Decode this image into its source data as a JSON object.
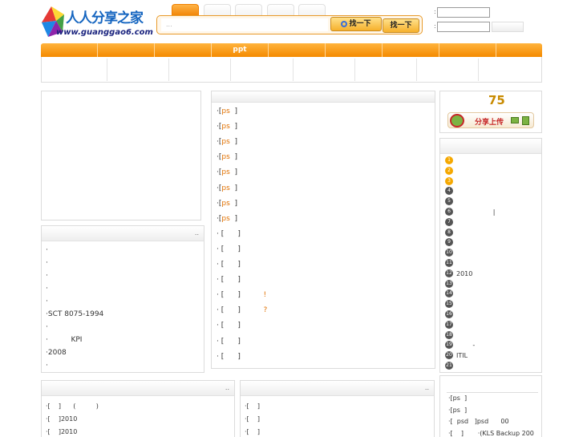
{
  "header": {
    "logo_text": "人人分享之家",
    "logo_url_text": "www.guanggao6.com",
    "search_placeholder": "...",
    "search_button_1": "找一下",
    "search_button_2": "找一下",
    "login_label_1": ":",
    "login_label_2": ":"
  },
  "nav": {
    "active_label": "ppt"
  },
  "news_list": [
    {
      "prefix": "·[",
      "tag": "ps",
      "suffix": "]"
    },
    {
      "prefix": "·[",
      "tag": "ps",
      "suffix": "]"
    },
    {
      "prefix": "·[",
      "tag": "ps",
      "suffix": "]"
    },
    {
      "prefix": "·[",
      "tag": "ps",
      "suffix": "]"
    },
    {
      "prefix": "·[",
      "tag": "ps",
      "suffix": "]"
    },
    {
      "prefix": "·[",
      "tag": "ps",
      "suffix": "]"
    },
    {
      "prefix": "·[",
      "tag": "ps",
      "suffix": "]"
    },
    {
      "prefix": "·[",
      "tag": "ps",
      "suffix": "]"
    },
    {
      "prefix": "· [",
      "tag": "",
      "suffix": "]",
      "extra": ""
    },
    {
      "prefix": "· [",
      "tag": "",
      "suffix": "]",
      "extra": ""
    },
    {
      "prefix": "· [",
      "tag": "",
      "suffix": "]",
      "extra": ""
    },
    {
      "prefix": "· [",
      "tag": "",
      "suffix": "]",
      "extra": ""
    },
    {
      "prefix": "· [",
      "tag": "",
      "suffix": "]",
      "extra": "!"
    },
    {
      "prefix": "· [",
      "tag": "",
      "suffix": "]",
      "extra": "?"
    },
    {
      "prefix": "· [",
      "tag": "",
      "suffix": "]",
      "extra": ""
    },
    {
      "prefix": "· [",
      "tag": "",
      "suffix": "]",
      "extra": ""
    },
    {
      "prefix": "· [",
      "tag": "",
      "suffix": "]",
      "extra": ""
    }
  ],
  "left_panel": {
    "more": "..",
    "items": [
      "·",
      "·",
      "·",
      "·",
      "·",
      "·SCT 8075-1994",
      "·",
      "·          KPI",
      "·2008",
      "·"
    ]
  },
  "upload_box": {
    "count": "75",
    "label": "分享上传"
  },
  "ranking": [
    {
      "n": "1",
      "text": ""
    },
    {
      "n": "2",
      "text": ""
    },
    {
      "n": "3",
      "text": ""
    },
    {
      "n": "4",
      "text": ""
    },
    {
      "n": "5",
      "text": ""
    },
    {
      "n": "6",
      "text": "                  |"
    },
    {
      "n": "7",
      "text": ""
    },
    {
      "n": "8",
      "text": ""
    },
    {
      "n": "9",
      "text": ""
    },
    {
      "n": "10",
      "text": ""
    },
    {
      "n": "11",
      "text": ""
    },
    {
      "n": "12",
      "text": "2010"
    },
    {
      "n": "13",
      "text": ""
    },
    {
      "n": "14",
      "text": ""
    },
    {
      "n": "15",
      "text": ""
    },
    {
      "n": "16",
      "text": ""
    },
    {
      "n": "17",
      "text": ""
    },
    {
      "n": "18",
      "text": ""
    },
    {
      "n": "19",
      "text": "        -"
    },
    {
      "n": "20",
      "text": "ITIL"
    },
    {
      "n": "21",
      "text": ""
    }
  ],
  "bottom_left": {
    "more": "..",
    "items": [
      "·[    ]      (          )",
      "·[    ]2010",
      "·[    ]2010"
    ]
  },
  "bottom_mid": {
    "more": "..",
    "items": [
      "·[    ]",
      "·[    ]",
      "·[    ]"
    ]
  },
  "bottom_right": {
    "items": [
      "·[ps  ]",
      "·[ps  ]",
      "·[  psd   ]psd      00",
      "·[    ]       ·(KLS Backup 200"
    ]
  }
}
